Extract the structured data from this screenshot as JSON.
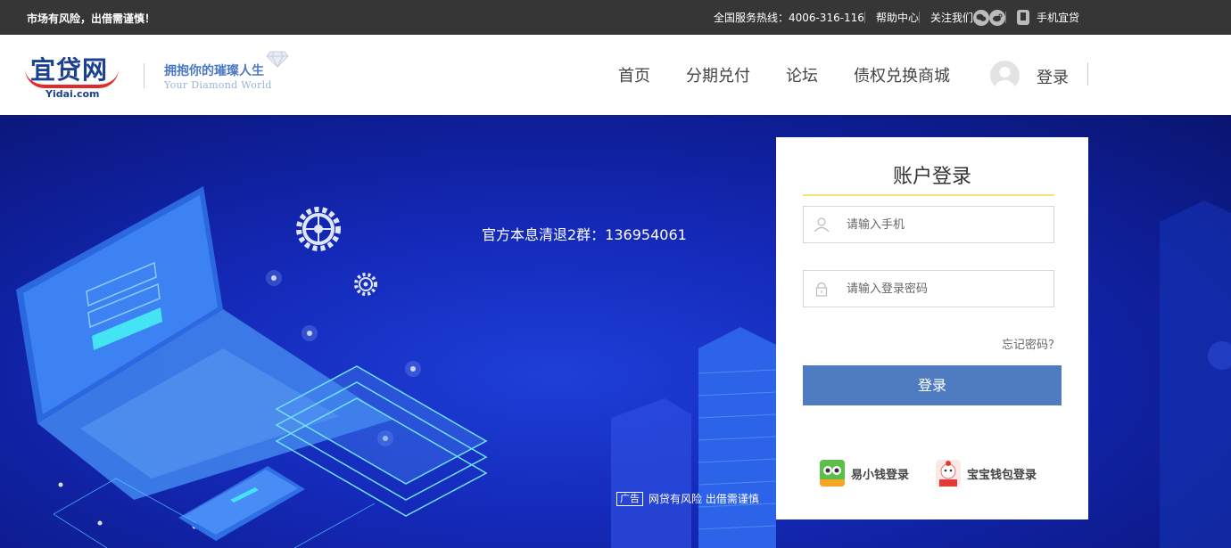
{
  "topbar": {
    "warning": "市场有风险，出借需谨慎！",
    "hotline": "全国服务热线：4006-316-116",
    "help": "帮助中心",
    "follow": "关注我们",
    "mobile": "手机宜贷"
  },
  "header": {
    "logo_cn": "宜贷网",
    "logo_en": "Yidai.com",
    "slogan_cn": "拥抱你的璀璨人生",
    "slogan_en": "Your Diamond World",
    "nav": [
      "首页",
      "分期兑付",
      "论坛",
      "债权兑换商城"
    ],
    "login": "登录"
  },
  "banner": {
    "promo": "官方本息清退2群：136954061",
    "ad_tag": "广告",
    "ad_text": "网贷有风险 出借需谨慎"
  },
  "login_card": {
    "title": "账户登录",
    "phone_placeholder": "请输入手机",
    "password_placeholder": "请输入登录密码",
    "forgot": "忘记密码？",
    "submit": "登录",
    "alt_logins": [
      "易小钱登录",
      "宝宝钱包登录"
    ]
  },
  "colors": {
    "topbar_bg": "#363636",
    "banner_blue": "#1429b8",
    "button_blue": "#4f7cc0",
    "title_underline": "#f5e27a",
    "logo_navy": "#1b3f91",
    "logo_red": "#e02b2b"
  }
}
